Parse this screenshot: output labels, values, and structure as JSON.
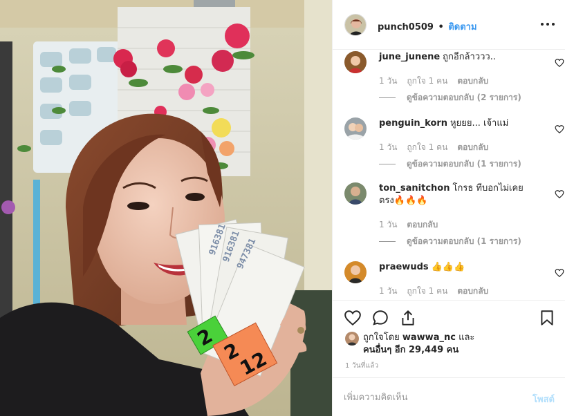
{
  "post": {
    "username": "punch0509",
    "separator": "•",
    "follow_label": "ติดตาม"
  },
  "comments": [
    {
      "username": "june_junene",
      "text": "ถูกอีกล้าววว..",
      "time": "1 วัน",
      "likes": "ถูกใจ 1 คน",
      "reply_label": "ตอบกลับ",
      "view_replies": "ดูข้อความตอบกลับ (2 รายการ)",
      "avatar_color": "#8a5a2c"
    },
    {
      "username": "penguin_korn",
      "text": "หูยยย... เจ้าแม่",
      "time": "1 วัน",
      "likes": "ถูกใจ 1 คน",
      "reply_label": "ตอบกลับ",
      "view_replies": "ดูข้อความตอบกลับ (1 รายการ)",
      "avatar_color": "#9aa3a8"
    },
    {
      "username": "ton_sanitchon",
      "text": "โกรธ ทีบอกไม่เคยตรง🔥🔥🔥",
      "time": "1 วัน",
      "reply_label": "ตอบกลับ",
      "view_replies": "ดูข้อความตอบกลับ (1 รายการ)",
      "avatar_color": "#7b8a6d"
    },
    {
      "username": "praewuds",
      "text": "👍👍👍",
      "time": "1 วัน",
      "likes": "ถูกใจ 1 คน",
      "reply_label": "ตอบกลับ",
      "avatar_color": "#d48a2a"
    }
  ],
  "actions": {
    "like_icon": "heart-icon",
    "comment_icon": "comment-icon",
    "share_icon": "share-icon",
    "save_icon": "bookmark-icon"
  },
  "likes": {
    "prefix": "ถูกใจโดย",
    "user": "wawwa_nc",
    "and": "และ",
    "others": "คนอื่นๆ อีก 29,449 คน"
  },
  "time_ago": "1 วันที่แล้ว",
  "composer": {
    "placeholder": "เพิ่มความคิดเห็น",
    "post_label": "โพสต์"
  },
  "colors": {
    "link": "#3897f0",
    "post_disabled": "#b2dffc",
    "muted": "#999999"
  }
}
